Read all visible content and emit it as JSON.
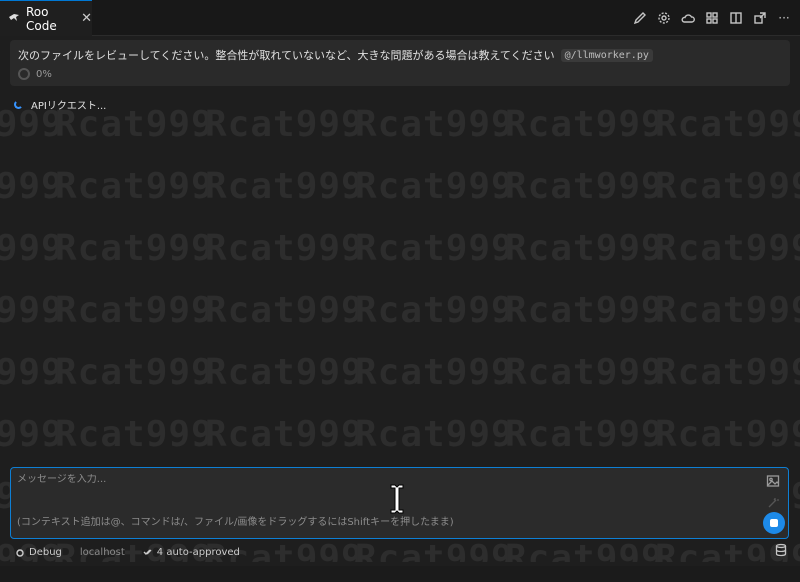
{
  "tab": {
    "title": "Roo Code",
    "close": "✕"
  },
  "toolbar": {
    "icons": [
      "edit-icon",
      "settings-icon",
      "cloud-icon",
      "marketplace-icon",
      "split-icon",
      "popout-icon",
      "more-icon"
    ],
    "more": "···"
  },
  "task": {
    "text": "次のファイルをレビューしてください。整合性が取れていないなど、大きな問題がある場合は教えてください",
    "mention": "@/llmworker.py",
    "progress": "0%"
  },
  "api_status": {
    "label": "APIリクエスト..."
  },
  "watermark": {
    "text": "Rcat999"
  },
  "chat": {
    "placeholder": "メッセージを入力...",
    "hint": "(コンテキスト追加は@、コマンドは/、ファイル/画像をドラッグするにはShiftキーを押したまま)"
  },
  "bottom": {
    "mode": "Debug",
    "model": "localhost",
    "auto_approved": "4 auto-approved"
  },
  "colors": {
    "accent": "#0e7fd4",
    "stop_button": "#1d8ae8",
    "background": "#1e1e1e"
  }
}
